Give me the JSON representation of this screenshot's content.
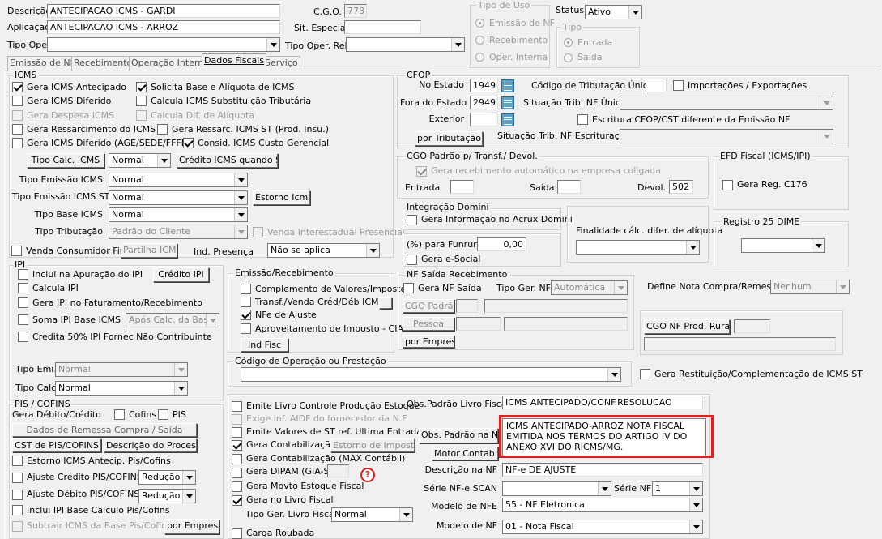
{
  "header": {
    "descricao_label": "Descrição",
    "descricao_value": "ANTECIPACAO ICMS - GARDI",
    "aplicacao_label": "Aplicação",
    "aplicacao_value": "ANTECIPACAO ICMS - ARROZ",
    "tipo_oper_label": "Tipo Oper.",
    "cgo_label": "C.G.O.",
    "cgo_value": "778",
    "sit_especial_label": "Sit. Especial",
    "tipo_oper_rel_label": "Tipo Oper. Rel.",
    "tipo_uso_title": "Tipo de Uso",
    "uso_opts": [
      "Emissão de NF",
      "Recebimento",
      "Oper. Interna"
    ],
    "status_label": "Status",
    "status_value": "Ativo",
    "tipo_title": "Tipo",
    "tipo_opts": [
      "Entrada",
      "Saída"
    ]
  },
  "tabs": [
    "Emissão de NF",
    "Recebimento",
    "Operação Interna",
    "Dados Fiscais",
    "Serviço"
  ],
  "icms": {
    "title": "ICMS",
    "cb": {
      "gera_antecipado": "Gera ICMS Antecipado",
      "solicita_base": "Solicita Base e Alíquota de ICMS",
      "gera_diferido": "Gera ICMS Diferido",
      "calcula_st": "Calcula ICMS Substituição Tributária",
      "gera_despesa": "Gera Despesa ICMS",
      "calcula_dif": "Calcula Dif. de Alíquota",
      "gera_ressarc": "Gera Ressarcimento do ICMS ST",
      "gera_ressarc_prod": "Gera Ressarc. ICMS ST (Prod. Insu.)",
      "gera_dif_age": "Gera ICMS Diferido (AGE/SEDE/FFFD)",
      "consid_custo": "Consid. ICMS Custo Gerencial"
    },
    "tipo_calc_btn": "Tipo Calc. ICMS",
    "tipo_calc_value": "Normal",
    "credito_st_btn": "Crédito ICMS quando ST",
    "tipo_emissao_label": "Tipo Emissão ICMS",
    "tipo_emissao_value": "Normal",
    "tipo_emissao_st_label": "Tipo Emissão ICMS ST",
    "tipo_emissao_st_value": "Normal",
    "estorno_btn": "Estorno Icms",
    "tipo_base_label": "Tipo Base ICMS",
    "tipo_base_value": "Normal",
    "tipo_trib_label": "Tipo Tributação",
    "tipo_trib_value": "Padrão do Cliente",
    "venda_inter": "Venda Interestadual Presencial",
    "venda_consumidor": "Venda Consumidor Final",
    "partilha_btn": "Partilha ICMS",
    "ind_presenca_label": "Ind. Presença",
    "ind_presenca_value": "Não se aplica"
  },
  "cfop": {
    "title": "CFOP",
    "no_estado_label": "No Estado",
    "no_estado_value": "1949",
    "fora_estado_label": "Fora do Estado",
    "fora_estado_value": "2949",
    "exterior_label": "Exterior",
    "por_trib_btn": "por Tributação...",
    "cod_trib_label": "Código de Tributação Único",
    "import_export": "Importações / Exportações",
    "sit_trib_label": "Situação Trib. NF Única",
    "escritura": "Escritura CFOP/CST diferente da Emissão NF",
    "sit_escrit_label": "Situação Trib. NF Escrituração"
  },
  "cgo_padrao": {
    "title": "CGO Padrão p/ Transf./ Devol.",
    "gera_receb": "Gera recebimento automático na empresa coligada",
    "entrada_label": "Entrada",
    "saida_label": "Saída",
    "devol_label": "Devol.",
    "devol_value": "502"
  },
  "efd": {
    "title": "EFD Fiscal (ICMS/IPI)",
    "gera_c176": "Gera Reg. C176"
  },
  "integracao": {
    "title": "Integração Domini",
    "gera_info": "Gera Informação no Acrux Domini"
  },
  "finalidade": {
    "label": "Finalidade cálc. difer. de alíquota"
  },
  "registro25": {
    "title": "Registro 25 DIME"
  },
  "funrural": {
    "label": "(%) para Funrural",
    "value": "0,00",
    "esocial": "Gera e-Social"
  },
  "ipi": {
    "title": "IPI",
    "inclui_apur": "Inclui na Apuração do IPI",
    "credito_btn": "Crédito IPI",
    "calcula": "Calcula IPI",
    "gera_fat": "Gera IPI no Faturamento/Recebimento",
    "soma_base": "Soma IPI Base ICMS",
    "soma_value": "Após Calc. da Base",
    "credita50": "Credita 50% IPI Fornec Não Contribuinte",
    "tipo_emi_label": "Tipo Emi.",
    "tipo_emi_value": "Normal",
    "tipo_calc_label": "Tipo Calc.",
    "tipo_calc_value": "Normal"
  },
  "emissao": {
    "title": "Emissão/Recebimento",
    "complemento": "Complemento de Valores/Impostos",
    "transf": "Transf./Venda Créd/Déb ICMS",
    "nfe_ajuste": "NFe de Ajuste",
    "aproveitamento": "Aproveitamento de Imposto - CIAP",
    "ind_fisc_btn": "Ind Fisc"
  },
  "nf_saida": {
    "title": "NF Saída Recebimento",
    "gera_nf": "Gera NF Saída",
    "tipo_ger_label": "Tipo Ger. NF",
    "tipo_ger_value": "Automática",
    "cgo_padrao_btn": "CGO Padrão",
    "pessoa_btn": "Pessoa",
    "por_empresa_btn": "por Empresa"
  },
  "define_nota": {
    "label": "Define Nota Compra/Remessa",
    "value": "Nenhum",
    "cgo_rural_btn": "CGO NF Prod. Rural"
  },
  "cod_oper": {
    "title": "Código de Operação ou Prestação"
  },
  "gera_restit": "Gera Restituição/Complementação de ICMS ST",
  "pis": {
    "title": "PIS / COFINS",
    "gera_label": "Gera Débito/Crédito",
    "cofins": "Cofins",
    "pis": "PIS",
    "dados_remessa_btn": "Dados de Remessa Compra / Saída",
    "cst_btn": "CST de PIS/COFINS",
    "descricao_btn": "Descrição do Processo",
    "estorno_antecip": "Estorno ICMS Antecip. Pis/Cofins",
    "ajuste_credito": "Ajuste Crédito PIS/COFINS",
    "ajuste_credito_value": "Redução",
    "ajuste_debito": "Ajuste Débito PIS/COFINS",
    "ajuste_debito_value": "Redução",
    "inclui_ipi": "Inclui IPI Base Calculo Pis/Cofins",
    "subtrai_icms": "Subtrair ICMS da Base Pis/Cofins",
    "por_empresa_btn": "por Empresa"
  },
  "bottom": {
    "emite_livro": "Emite Livro Controle Produção Estoque",
    "exige_aidf": "Exige inf. AIDF do fornecedor da N.F.",
    "emite_valores": "Emite Valores de ST ref. Ultima Entrada",
    "gera_contab": "Gera Contabilização",
    "estorno_imp_btn": "Estorno de Impostos",
    "gera_contab_max": "Gera Contabilização (MAX Contábil)",
    "gera_dipam": "Gera DIPAM (GIA-SP)",
    "gera_movto": "Gera Movto Estoque Fiscal",
    "gera_livro": "Gera no Livro Fiscal",
    "tipo_ger_livro_label": "Tipo Ger. Livro Fiscal",
    "tipo_ger_livro_value": "Normal",
    "carga_roubada": "Carga Roubada",
    "obs_padrao_livro_label": "Obs.Padrão Livro Fiscal",
    "obs_padrao_livro_value": "ICMS ANTECIPADO/CONF.RESOLUCAO",
    "obs_padrao_nf_btn": "Obs. Padrão na NF",
    "obs_memo": "ICMS ANTECIPADO-ARROZ NOTA FISCAL EMITIDA NOS TERMOS DO ARTIGO IV DO ANEXO XVI DO RICMS/MG.",
    "motor_btn": "Motor Contab.",
    "descricao_nf_label": "Descrição na NF",
    "descricao_nf_value": "NF-e DE AJUSTE",
    "serie_scan_label": "Série NF-e SCAN",
    "serie_nf_label": "Série NF",
    "serie_nf_value": "1",
    "modelo_nfe_label": "Modelo de NFE",
    "modelo_nfe_value": "55 - NF Eletronica",
    "modelo_nf_label": "Modelo de NF",
    "modelo_nf_value": "01 - Nota Fiscal",
    "help_icon": "?"
  }
}
